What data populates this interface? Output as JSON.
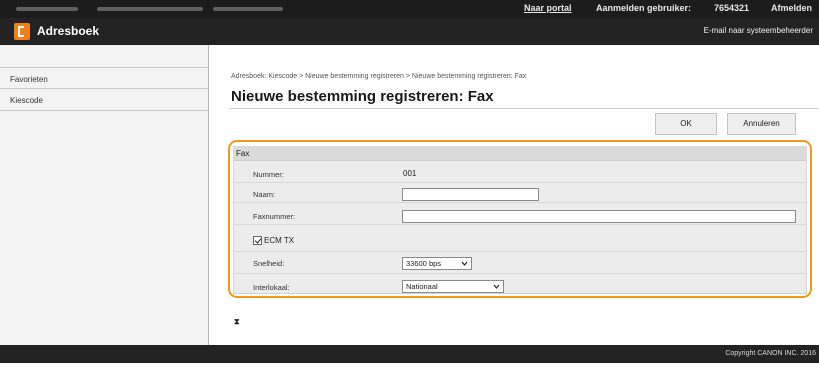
{
  "topbar": {
    "portal_link": "Naar portal",
    "login_user_label": "Aanmelden gebruiker:",
    "user_id": "7654321",
    "logout_link": "Afmelden"
  },
  "header": {
    "app_title": "Adresboek",
    "mail_admin_link": "E-mail naar systeembeheerder",
    "logo_icon": "address-book-icon",
    "accent_color": "#f07f18"
  },
  "sidebar": {
    "items": [
      {
        "label": "Favorieten"
      },
      {
        "label": "Kiescode"
      }
    ]
  },
  "main": {
    "breadcrumb": "Adresboek: Kiescode > Nieuwe bestemming registreren > Nieuwe bestemming registreren: Fax",
    "page_title": "Nieuwe bestemming registreren: Fax",
    "ok_label": "OK",
    "cancel_label": "Annuleren"
  },
  "form": {
    "section_title": "Fax",
    "number_label": "Nummer:",
    "number_value": "001",
    "name_label": "Naam:",
    "name_value": "",
    "faxnumber_label": "Faxnummer:",
    "faxnumber_value": "",
    "ecm_label": "ECM TX",
    "ecm_checked": true,
    "speed_label": "Snelheid:",
    "speed_value": "33600 bps",
    "interlocal_label": "Interlokaal:",
    "interlocal_value": "Nationaal",
    "highlight_color": "#f29a18"
  },
  "footer": {
    "copyright": "Copyright CANON INC. 2016"
  }
}
